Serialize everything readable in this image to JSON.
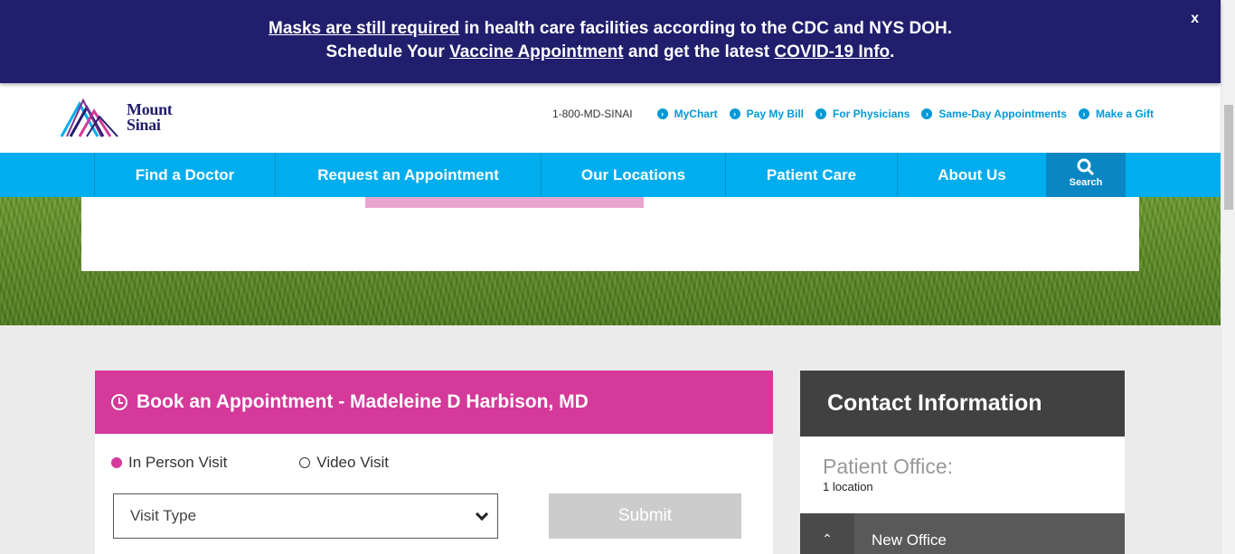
{
  "alert": {
    "line1_link": "Masks are still required",
    "line1_rest": " in health care facilities according to the CDC and NYS DOH.",
    "line2_pre": "Schedule Your ",
    "line2_link1": "Vaccine Appointment",
    "line2_mid": " and get the latest ",
    "line2_link2": "COVID-19 Info",
    "line2_end": ".",
    "close": "x"
  },
  "header": {
    "logo_line1": "Mount",
    "logo_line2": "Sinai",
    "phone": "1-800-MD-SINAI",
    "links": [
      "MyChart",
      "Pay My Bill",
      "For Physicians",
      "Same-Day Appointments",
      "Make a Gift"
    ]
  },
  "nav": {
    "items": [
      "Find a Doctor",
      "Request an Appointment",
      "Our Locations",
      "Patient Care",
      "About Us"
    ],
    "search": "Search"
  },
  "booking": {
    "title": "Book an Appointment - Madeleine D Harbison, MD",
    "radio_in_person": "In Person Visit",
    "radio_video": "Video Visit",
    "select_placeholder": "Visit Type",
    "submit": "Submit"
  },
  "contact": {
    "title": "Contact Information",
    "office_label": "Patient Office:",
    "office_count": "1 location",
    "office_name": "New Office"
  },
  "colors": {
    "banner": "#211e6d",
    "nav": "#00aeef",
    "accent": "#d5399a",
    "contact_header": "#414141"
  }
}
